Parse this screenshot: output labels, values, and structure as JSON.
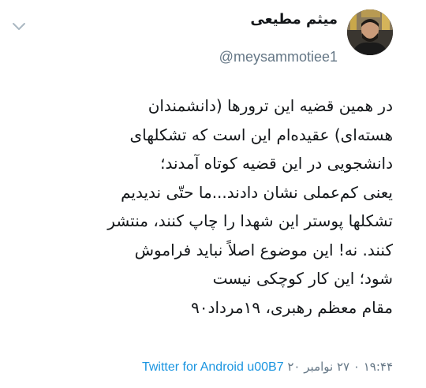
{
  "author": {
    "name": "میثم مطیعی",
    "handle": "@meysammotiee1"
  },
  "tweet": {
    "lines": [
      "در همین قضیه این ترورها (دانشمندان",
      "هسته‌ای) عقیده‌ام این است که تشکلهای",
      "دانشجویی در این قضیه کوتاه آمدند؛",
      "یعنی کم‌عملی نشان دادند...ما حتّی ندیدیم",
      "تشکلها پوستر این شهدا را چاپ کنند، منتشر",
      "کنند. نه! این موضوع اصلاً نباید فراموش",
      "شود؛ این کار کوچکی نیست",
      "مقام معظم رهبری، ۱۹مرداد۹۰"
    ]
  },
  "meta": {
    "time": "۱۹:۴۴ ۰ ۲۷ نوامبر ۲۰",
    "source": "Twitter for Android u00B7"
  },
  "icons": {
    "caret": "chevron-down-icon"
  },
  "colors": {
    "text": "#14171a",
    "secondary": "#657786",
    "link": "#1b95e0"
  }
}
